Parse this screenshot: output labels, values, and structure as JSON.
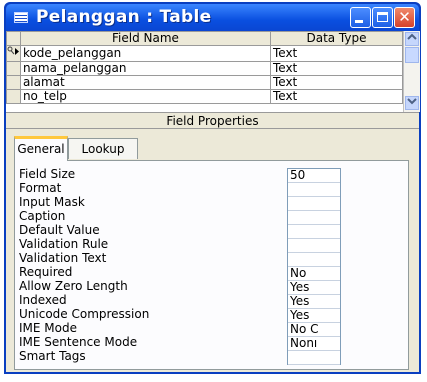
{
  "window": {
    "title": "Pelanggan : Table",
    "icon": "table-icon",
    "buttons": [
      "minimize-icon",
      "maximize-icon",
      "close-icon"
    ]
  },
  "grid": {
    "headers": {
      "field_name": "Field Name",
      "data_type": "Data Type"
    },
    "rows": [
      {
        "indicator": "key-arrow-icon",
        "field_name": "kode_pelanggan",
        "data_type": "Text"
      },
      {
        "indicator": "",
        "field_name": "nama_pelanggan",
        "data_type": "Text"
      },
      {
        "indicator": "",
        "field_name": "alamat",
        "data_type": "Text"
      },
      {
        "indicator": "",
        "field_name": "no_telp",
        "data_type": "Text"
      }
    ]
  },
  "field_properties": {
    "header": "Field Properties",
    "tabs": [
      "General",
      "Lookup"
    ],
    "active_tab": "General",
    "properties": [
      {
        "label": "Field Size",
        "value": "50"
      },
      {
        "label": "Format",
        "value": ""
      },
      {
        "label": "Input Mask",
        "value": ""
      },
      {
        "label": "Caption",
        "value": ""
      },
      {
        "label": "Default Value",
        "value": ""
      },
      {
        "label": "Validation Rule",
        "value": ""
      },
      {
        "label": "Validation Text",
        "value": ""
      },
      {
        "label": "Required",
        "value": "No"
      },
      {
        "label": "Allow Zero Length",
        "value": "Yes"
      },
      {
        "label": "Indexed",
        "value": "Yes"
      },
      {
        "label": "Unicode Compression",
        "value": "Yes"
      },
      {
        "label": "IME Mode",
        "value": "No C"
      },
      {
        "label": "IME Sentence Mode",
        "value": "Nonı"
      },
      {
        "label": "Smart Tags",
        "value": ""
      }
    ]
  },
  "colors": {
    "titlebar": "#0a4fe0",
    "close_button": "#d5412a",
    "dialog_bg": "#ece9d8",
    "active_tab_accent": "#ffc83c"
  }
}
